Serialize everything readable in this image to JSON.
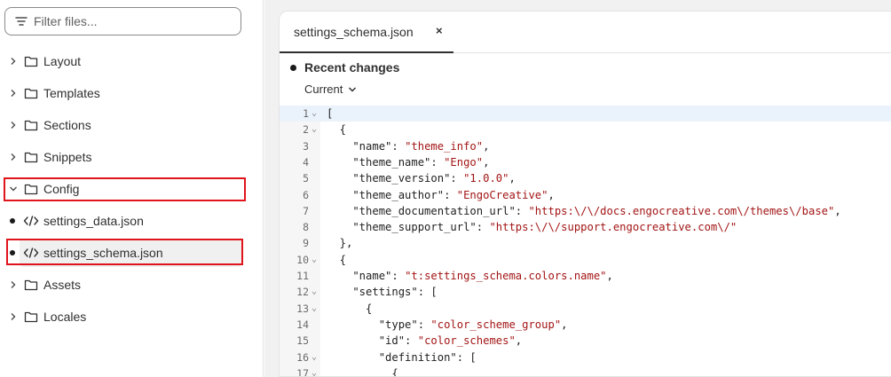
{
  "sidebar": {
    "filter_placeholder": "Filter files...",
    "items": [
      {
        "label": "Layout"
      },
      {
        "label": "Templates"
      },
      {
        "label": "Sections"
      },
      {
        "label": "Snippets"
      },
      {
        "label": "Config"
      },
      {
        "label": "settings_data.json"
      },
      {
        "label": "settings_schema.json"
      },
      {
        "label": "Assets"
      },
      {
        "label": "Locales"
      }
    ]
  },
  "editor": {
    "tab_label": "settings_schema.json",
    "tab_close": "×",
    "changes_title": "Recent changes",
    "changes_version": "Current",
    "lines": [
      {
        "n": "1",
        "fold": "⌄",
        "code": "["
      },
      {
        "n": "2",
        "fold": "⌄",
        "code": "  {"
      },
      {
        "n": "3",
        "fold": "",
        "key": "    \"name\": ",
        "val": "\"theme_info\"",
        "end": ","
      },
      {
        "n": "4",
        "fold": "",
        "key": "    \"theme_name\": ",
        "val": "\"Engo\"",
        "end": ","
      },
      {
        "n": "5",
        "fold": "",
        "key": "    \"theme_version\": ",
        "val": "\"1.0.0\"",
        "end": ","
      },
      {
        "n": "6",
        "fold": "",
        "key": "    \"theme_author\": ",
        "val": "\"EngoCreative\"",
        "end": ","
      },
      {
        "n": "7",
        "fold": "",
        "key": "    \"theme_documentation_url\": ",
        "val": "\"https:\\/\\/docs.engocreative.com\\/themes\\/base\"",
        "end": ","
      },
      {
        "n": "8",
        "fold": "",
        "key": "    \"theme_support_url\": ",
        "val": "\"https:\\/\\/support.engocreative.com\\/\"",
        "end": ""
      },
      {
        "n": "9",
        "fold": "",
        "code": "  },"
      },
      {
        "n": "10",
        "fold": "⌄",
        "code": "  {"
      },
      {
        "n": "11",
        "fold": "",
        "key": "    \"name\": ",
        "val": "\"t:settings_schema.colors.name\"",
        "end": ","
      },
      {
        "n": "12",
        "fold": "⌄",
        "code": "    \"settings\": ["
      },
      {
        "n": "13",
        "fold": "⌄",
        "code": "      {"
      },
      {
        "n": "14",
        "fold": "",
        "key": "        \"type\": ",
        "val": "\"color_scheme_group\"",
        "end": ","
      },
      {
        "n": "15",
        "fold": "",
        "key": "        \"id\": ",
        "val": "\"color_schemes\"",
        "end": ","
      },
      {
        "n": "16",
        "fold": "⌄",
        "code": "        \"definition\": ["
      },
      {
        "n": "17",
        "fold": "⌄",
        "code": "          {"
      }
    ]
  },
  "colors": {
    "string": "#a31515",
    "highlight_border": "#e0141b",
    "active_line": "#eaf2fc"
  }
}
